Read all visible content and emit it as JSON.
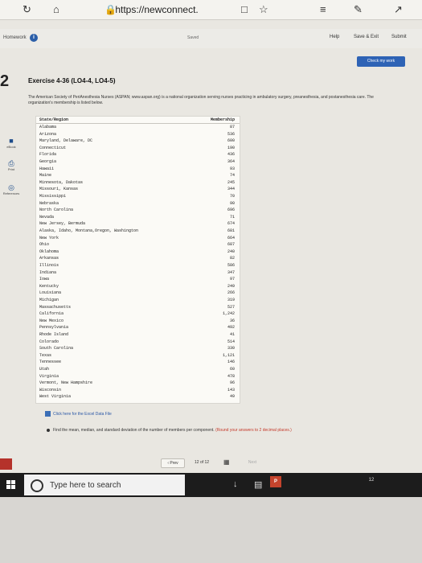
{
  "browser": {
    "url": "https://newconnect.",
    "icons": [
      "refresh-icon",
      "home-icon",
      "lock-icon",
      "tab-icon",
      "star-icon",
      "favorites-icon",
      "pen-icon",
      "share-icon"
    ]
  },
  "toolbar": {
    "homework_label": "Homework",
    "saved_label": "Saved",
    "help_label": "Help",
    "save_exit_label": "Save & Exit",
    "submit_label": "Submit",
    "check_work_label": "Check my work"
  },
  "left_rail": {
    "question_number": "2",
    "items": [
      "eBook",
      "Print",
      "References"
    ]
  },
  "exercise": {
    "title": "Exercise 4-36 (LO4-4, LO4-5)",
    "intro": "The American Society of PeriAnesthesia Nurses (ASPAN; www.aspan.org) is a national organization serving nurses practicing in ambulatory surgery, preanesthesia, and postanesthesia care. The organization's membership is listed below.",
    "table_header": {
      "region": "State/Region",
      "membership": "Membership"
    },
    "rows": [
      {
        "region": "Alabama",
        "membership": "87"
      },
      {
        "region": "Arizona",
        "membership": "536"
      },
      {
        "region": "Maryland, Delaware, DC",
        "membership": "600"
      },
      {
        "region": "Connecticut",
        "membership": "190"
      },
      {
        "region": "Florida",
        "membership": "436"
      },
      {
        "region": "Georgia",
        "membership": "364"
      },
      {
        "region": "Hawaii",
        "membership": "93"
      },
      {
        "region": "Maine",
        "membership": "74"
      },
      {
        "region": "Minnesota, Dakotas",
        "membership": "245"
      },
      {
        "region": "Missouri, Kansas",
        "membership": "344"
      },
      {
        "region": "Mississippi",
        "membership": "70"
      },
      {
        "region": "Nebraska",
        "membership": "90"
      },
      {
        "region": "North Carolina",
        "membership": "696"
      },
      {
        "region": "Nevada",
        "membership": "71"
      },
      {
        "region": "New Jersey, Bermuda",
        "membership": "674"
      },
      {
        "region": "Alaska, Idaho, Montana,Oregon, Washington",
        "membership": "681"
      },
      {
        "region": "New York",
        "membership": "664"
      },
      {
        "region": "Ohio",
        "membership": "687"
      },
      {
        "region": "Oklahoma",
        "membership": "240"
      },
      {
        "region": "Arkansas",
        "membership": "82"
      },
      {
        "region": "Illinois",
        "membership": "586"
      },
      {
        "region": "Indiana",
        "membership": "347"
      },
      {
        "region": "Iowa",
        "membership": "97"
      },
      {
        "region": "Kentucky",
        "membership": "249"
      },
      {
        "region": "Louisiana",
        "membership": "266"
      },
      {
        "region": "Michigan",
        "membership": "319"
      },
      {
        "region": "Massachusetts",
        "membership": "527"
      },
      {
        "region": "California",
        "membership": "1,242"
      },
      {
        "region": "New Mexico",
        "membership": "36"
      },
      {
        "region": "Pennsylvania",
        "membership": "492"
      },
      {
        "region": "Rhode Island",
        "membership": "41"
      },
      {
        "region": "Colorado",
        "membership": "514"
      },
      {
        "region": "South Carolina",
        "membership": "330"
      },
      {
        "region": "Texas",
        "membership": "1,121"
      },
      {
        "region": "Tennessee",
        "membership": "146"
      },
      {
        "region": "Utah",
        "membership": "60"
      },
      {
        "region": "Virginia",
        "membership": "478"
      },
      {
        "region": "Vermont, New Hampshire",
        "membership": "96"
      },
      {
        "region": "Wisconsin",
        "membership": "143"
      },
      {
        "region": "West Virginia",
        "membership": "49"
      }
    ],
    "excel_link": "Click here for the Excel Data File",
    "question": "Find the mean, median, and standard deviation of the number of members per component.",
    "question_note": "(Round your answers to 2 decimal places.)"
  },
  "navigation": {
    "prev_label": "Prev",
    "page_current": "12",
    "page_of": "of",
    "page_total": "12",
    "next_label": "Next"
  },
  "taskbar": {
    "search_placeholder": "Type here to search",
    "badge": "12"
  }
}
